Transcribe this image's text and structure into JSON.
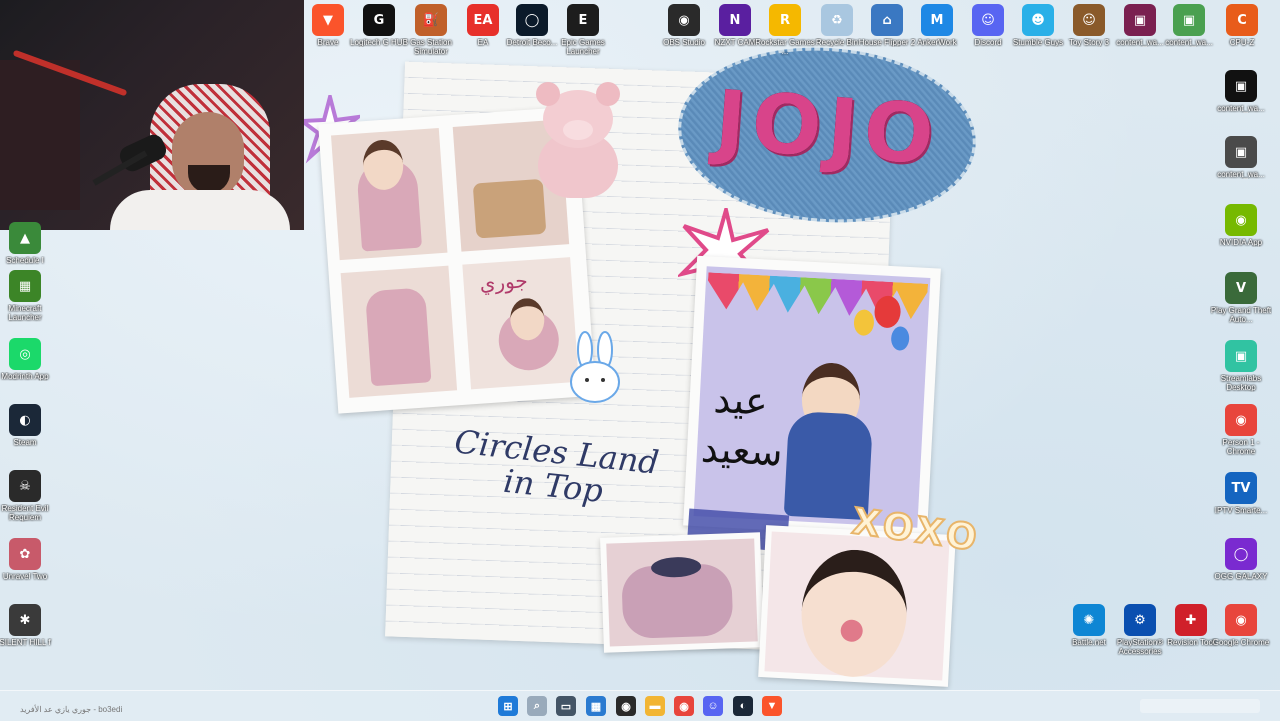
{
  "desktop": {
    "top_icons": [
      {
        "label": "Brave",
        "icon": "brave-icon",
        "color": "#fb542b",
        "glyph": "▼"
      },
      {
        "label": "Logitech G HUB",
        "icon": "logitech-icon",
        "color": "#111111",
        "glyph": "G"
      },
      {
        "label": "Gas Station Simulator",
        "icon": "gas-station-icon",
        "color": "#c0602a",
        "glyph": "⛽"
      },
      {
        "label": "EA",
        "icon": "ea-icon",
        "color": "#e7302a",
        "glyph": "EA"
      },
      {
        "label": "Detroit Beco...",
        "icon": "detroit-icon",
        "color": "#0b1a2a",
        "glyph": "◯"
      },
      {
        "label": "Epic Games Launcher",
        "icon": "epic-icon",
        "color": "#1d1d1d",
        "glyph": "E"
      },
      {
        "label": "OBS Studio",
        "icon": "obs-icon",
        "color": "#2a2a2a",
        "glyph": "◉"
      },
      {
        "label": "NZXT CAM",
        "icon": "nzxt-icon",
        "color": "#5a1fa0",
        "glyph": "N"
      },
      {
        "label": "Rockstar Games ...",
        "icon": "rockstar-icon",
        "color": "#f5b800",
        "glyph": "R"
      },
      {
        "label": "Recycle Bin",
        "icon": "recycle-bin-icon",
        "color": "#a9c7e0",
        "glyph": "♻"
      },
      {
        "label": "House Flipper 2",
        "icon": "house-icon",
        "color": "#3a78c2",
        "glyph": "⌂"
      },
      {
        "label": "AnkerWork",
        "icon": "ankerwork-icon",
        "color": "#1e88e5",
        "glyph": "M"
      },
      {
        "label": "Discord",
        "icon": "discord-icon",
        "color": "#5865f2",
        "glyph": "☺"
      },
      {
        "label": "Stumble Guys",
        "icon": "stumble-icon",
        "color": "#2ab0e8",
        "glyph": "☻"
      },
      {
        "label": "Toy Story 3",
        "icon": "toy-story-icon",
        "color": "#8a5a2a",
        "glyph": "☺"
      },
      {
        "label": "content_wa...",
        "icon": "image-file-icon",
        "color": "#7a2050",
        "glyph": "▣"
      },
      {
        "label": "content_wa...",
        "icon": "image-file-icon",
        "color": "#4aa050",
        "glyph": "▣"
      },
      {
        "label": "CPU-Z",
        "icon": "cpuz-icon",
        "color": "#e85c1a",
        "glyph": "C"
      }
    ],
    "left_icons": [
      {
        "label": "Schedule I",
        "icon": "schedule-icon",
        "color": "#3a8a3a",
        "glyph": "▲"
      },
      {
        "label": "Minecraft Launcher",
        "icon": "minecraft-icon",
        "color": "#3c8527",
        "glyph": "▦"
      },
      {
        "label": "Modrinth App",
        "icon": "modrinth-icon",
        "color": "#1bd96a",
        "glyph": "◎"
      },
      {
        "label": "Steam",
        "icon": "steam-icon",
        "color": "#1b2838",
        "glyph": "◐"
      },
      {
        "label": "Resident Evil Requiem",
        "icon": "resident-evil-icon",
        "color": "#2a2a2a",
        "glyph": "☠"
      },
      {
        "label": "Unravel Two",
        "icon": "unravel-icon",
        "color": "#c85a6a",
        "glyph": "✿"
      },
      {
        "label": "SILENT HILL f",
        "icon": "silent-hill-icon",
        "color": "#3a3a3a",
        "glyph": "✱"
      }
    ],
    "right_icons": [
      {
        "label": "content_wa...",
        "icon": "image-file-icon",
        "color": "#111111",
        "glyph": "▣"
      },
      {
        "label": "content_wa...",
        "icon": "image-file-icon",
        "color": "#4a4a4a",
        "glyph": "▣"
      },
      {
        "label": "NVIDIA App",
        "icon": "nvidia-icon",
        "color": "#76b900",
        "glyph": "◉"
      },
      {
        "label": "Play Grand Theft Auto...",
        "icon": "gta-icon",
        "color": "#3a6a3a",
        "glyph": "V"
      },
      {
        "label": "Streamlabs Desktop",
        "icon": "streamlabs-icon",
        "color": "#31c3a2",
        "glyph": "▣"
      },
      {
        "label": "Person 1 - Chrome",
        "icon": "chrome-icon",
        "color": "#e8453c",
        "glyph": "◉"
      },
      {
        "label": "IPTV Smarte...",
        "icon": "iptv-icon",
        "color": "#1565c0",
        "glyph": "TV"
      },
      {
        "label": "OGG GALAXY",
        "icon": "gog-icon",
        "color": "#7a2ad0",
        "glyph": "◯"
      }
    ],
    "bottom_right_icons": [
      {
        "label": "Battle.net",
        "icon": "battlenet-icon",
        "color": "#0e86d4",
        "glyph": "✺"
      },
      {
        "label": "PlayStation® Accessories",
        "icon": "playstation-icon",
        "color": "#0a4fb0",
        "glyph": "⚙"
      },
      {
        "label": "Revision Tool",
        "icon": "revision-tool-icon",
        "color": "#d0202a",
        "glyph": "✚"
      },
      {
        "label": "Google Chrome",
        "icon": "chrome-icon",
        "color": "#e8453c",
        "glyph": "◉"
      }
    ]
  },
  "wallpaper": {
    "patch_text": "JOJO",
    "note_text_line1": "Circles Land",
    "note_text_line2": "in Top",
    "card_text_line1": "عيد",
    "card_text_line2": "سعيد",
    "xoxo": "XOXO",
    "photo_caption": "جوري"
  },
  "taskbar": {
    "left_text": "جوري يازي عد الأفريد - bo3edi",
    "apps": [
      {
        "name": "start-button",
        "icon": "windows-icon",
        "color": "#1f7ad8",
        "glyph": "⊞"
      },
      {
        "name": "taskbar-search",
        "icon": "search-icon",
        "color": "#9ab",
        "glyph": "⌕"
      },
      {
        "name": "taskbar-task-view",
        "icon": "task-view-icon",
        "color": "#456",
        "glyph": "▭"
      },
      {
        "name": "taskbar-widgets",
        "icon": "widgets-icon",
        "color": "#2a7ad0",
        "glyph": "▦"
      },
      {
        "name": "taskbar-obs",
        "icon": "obs-icon",
        "color": "#2a2a2a",
        "glyph": "◉"
      },
      {
        "name": "taskbar-explorer",
        "icon": "folder-icon",
        "color": "#f2b533",
        "glyph": "▬"
      },
      {
        "name": "taskbar-chrome",
        "icon": "chrome-icon",
        "color": "#e8453c",
        "glyph": "◉"
      },
      {
        "name": "taskbar-discord",
        "icon": "discord-icon",
        "color": "#5865f2",
        "glyph": "☺"
      },
      {
        "name": "taskbar-steam",
        "icon": "steam-icon",
        "color": "#1b2838",
        "glyph": "◐"
      },
      {
        "name": "taskbar-brave",
        "icon": "brave-icon",
        "color": "#fb542b",
        "glyph": "▼"
      }
    ]
  }
}
